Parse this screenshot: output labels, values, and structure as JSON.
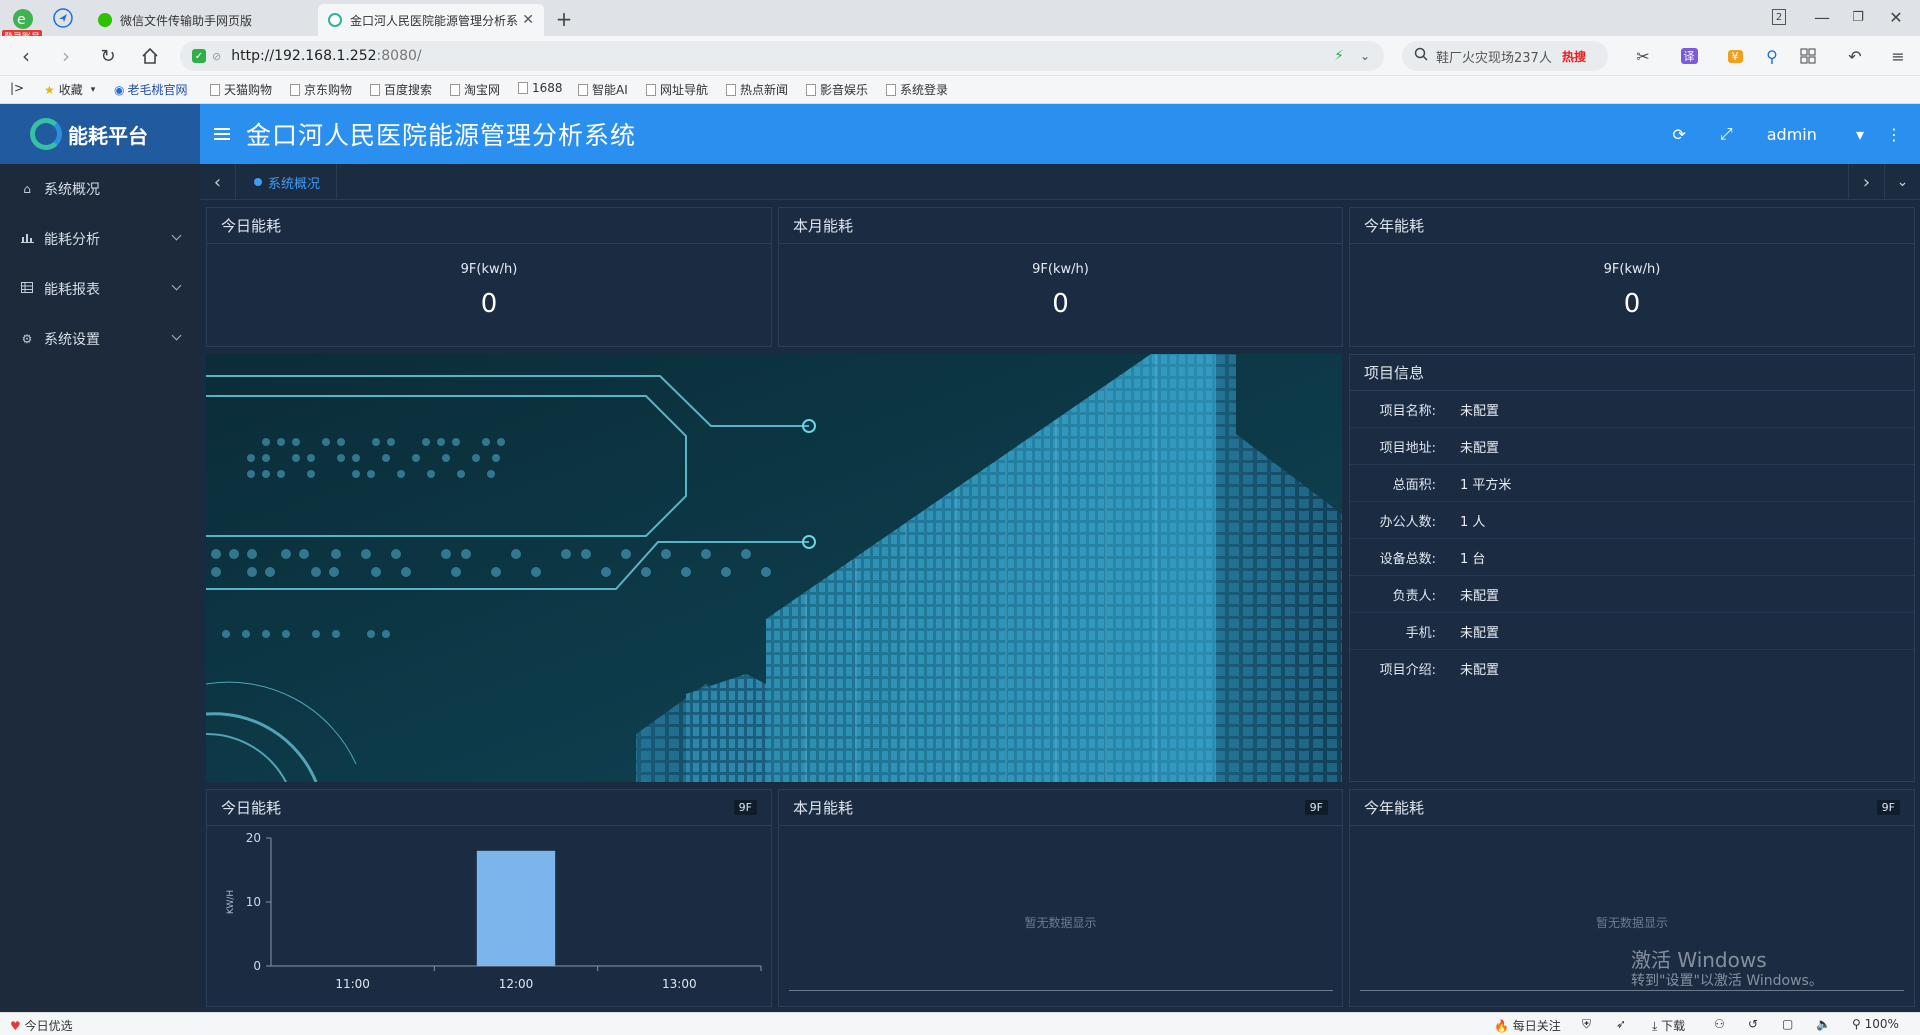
{
  "browser": {
    "login_badge": "登录账号",
    "tabs": [
      {
        "title": "微信文件传输助手网页版"
      },
      {
        "title": "金口河人民医院能源管理分析系"
      }
    ],
    "url_host": "http://192.168.1.252",
    "url_rest": ":8080/",
    "search_text": "鞋厂火灾现场237人",
    "search_hot": "热搜",
    "tab_count": "2",
    "bookmarks": [
      "收藏",
      "老毛桃官网",
      "天猫购物",
      "京东购物",
      "百度搜索",
      "淘宝网",
      "1688",
      "智能AI",
      "网址导航",
      "热点新闻",
      "影音娱乐",
      "系统登录"
    ]
  },
  "app": {
    "logo_text": "能耗平台",
    "title": "金口河人民医院能源管理分析系统",
    "user": "admin"
  },
  "sidebar": {
    "items": [
      {
        "label": "系统概况",
        "icon": "home-icon",
        "expandable": false
      },
      {
        "label": "能耗分析",
        "icon": "bar-chart-icon",
        "expandable": true
      },
      {
        "label": "能耗报表",
        "icon": "table-icon",
        "expandable": true
      },
      {
        "label": "系统设置",
        "icon": "gear-icon",
        "expandable": true
      }
    ]
  },
  "tabstrip": {
    "current": "系统概况"
  },
  "kpis": [
    {
      "title": "今日能耗",
      "unit": "9F(kw/h)",
      "value": "0"
    },
    {
      "title": "本月能耗",
      "unit": "9F(kw/h)",
      "value": "0"
    },
    {
      "title": "今年能耗",
      "unit": "9F(kw/h)",
      "value": "0"
    }
  ],
  "project_info": {
    "title": "项目信息",
    "rows": [
      {
        "label": "项目名称:",
        "value": "未配置"
      },
      {
        "label": "项目地址:",
        "value": "未配置"
      },
      {
        "label": "总面积:",
        "value": "1 平方米"
      },
      {
        "label": "办公人数:",
        "value": "1 人"
      },
      {
        "label": "设备总数:",
        "value": "1 台"
      },
      {
        "label": "负责人:",
        "value": "未配置"
      },
      {
        "label": "手机:",
        "value": "未配置"
      },
      {
        "label": "项目介绍:",
        "value": "未配置"
      }
    ]
  },
  "charts": [
    {
      "title": "今日能耗",
      "badge": "9F"
    },
    {
      "title": "本月能耗",
      "badge": "9F",
      "empty_text": "暂无数据显示"
    },
    {
      "title": "今年能耗",
      "badge": "9F",
      "empty_text": "暂无数据显示"
    }
  ],
  "chart_data": {
    "type": "bar",
    "categories": [
      "11:00",
      "12:00",
      "13:00"
    ],
    "values": [
      0,
      18,
      0
    ],
    "ylabel": "KW/H",
    "ylim": [
      0,
      20
    ],
    "yticks": [
      0,
      10,
      20
    ],
    "color": "#7cb5ec",
    "grid": false
  },
  "statusbar": {
    "left": "今日优选",
    "items": [
      "每日关注",
      "下载",
      "100%"
    ]
  },
  "watermark": {
    "title": "激活 Windows",
    "subtitle": "转到\"设置\"以激活 Windows。"
  },
  "colors": {
    "header_blue": "#2b8ff0",
    "logo_blue": "#215a9e",
    "panel_bg": "#1a2b42",
    "bar": "#7cb5ec",
    "accent": "#3f9cf7"
  }
}
